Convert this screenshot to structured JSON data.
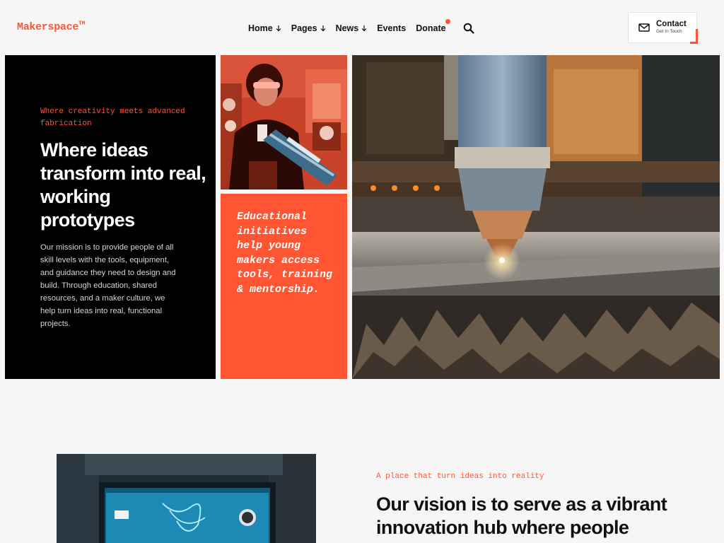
{
  "header": {
    "logo": "Makerspace",
    "logo_mark": "TM",
    "nav": [
      {
        "label": "Home",
        "has_dropdown": true
      },
      {
        "label": "Pages",
        "has_dropdown": true
      },
      {
        "label": "News",
        "has_dropdown": true
      },
      {
        "label": "Events",
        "has_dropdown": false
      },
      {
        "label": "Donate",
        "has_dropdown": false,
        "has_dot": true
      }
    ],
    "search_icon": "search-icon",
    "contact": {
      "label": "Contact",
      "sub": "Get In Touch",
      "icon": "mail-icon"
    }
  },
  "hero": {
    "kicker": "Where creativity meets advanced fabrication",
    "title": "Where ideas transform into real, working prototypes",
    "text": "Our mission is to provide people of all skill levels with the tools, equipment, and guidance they need to design and build. Through education, shared resources, and a maker culture, we help turn ideas into real, functional projects.",
    "callout": "Educational initiatives help young makers access tools, training & mentorship."
  },
  "section2": {
    "kicker": "A place that turn ideas into reality",
    "title": "Our vision is to serve as a vibrant innovation hub where people"
  },
  "colors": {
    "accent": "#ff5533",
    "dark": "#000000",
    "background": "#f6f6f6"
  }
}
